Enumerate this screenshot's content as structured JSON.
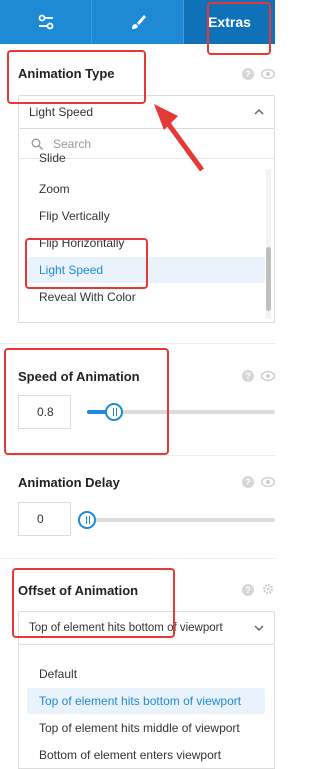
{
  "tabs": [
    {
      "name": "settings-sliders-icon",
      "label": ""
    },
    {
      "name": "brush-icon",
      "label": ""
    },
    {
      "name": "extras-tab",
      "label": "Extras"
    }
  ],
  "animation_type": {
    "title": "Animation Type",
    "selected": "Light Speed",
    "search_placeholder": "Search",
    "options": [
      "Slide",
      "Zoom",
      "Flip Vertically",
      "Flip Horizontally",
      "Light Speed",
      "Reveal With Color"
    ],
    "selected_option": "Light Speed"
  },
  "speed": {
    "title": "Speed of Animation",
    "value": "0.8"
  },
  "delay": {
    "title": "Animation Delay",
    "value": "0"
  },
  "offset": {
    "title": "Offset of Animation",
    "selected": "Top of element hits bottom of viewport",
    "options": [
      "Default",
      "Top of element hits bottom of viewport",
      "Top of element hits middle of viewport",
      "Bottom of element enters viewport"
    ],
    "selected_option": "Top of element hits bottom of viewport"
  },
  "colors": {
    "accent": "#1e8ad6",
    "annotation": "#e53935"
  }
}
